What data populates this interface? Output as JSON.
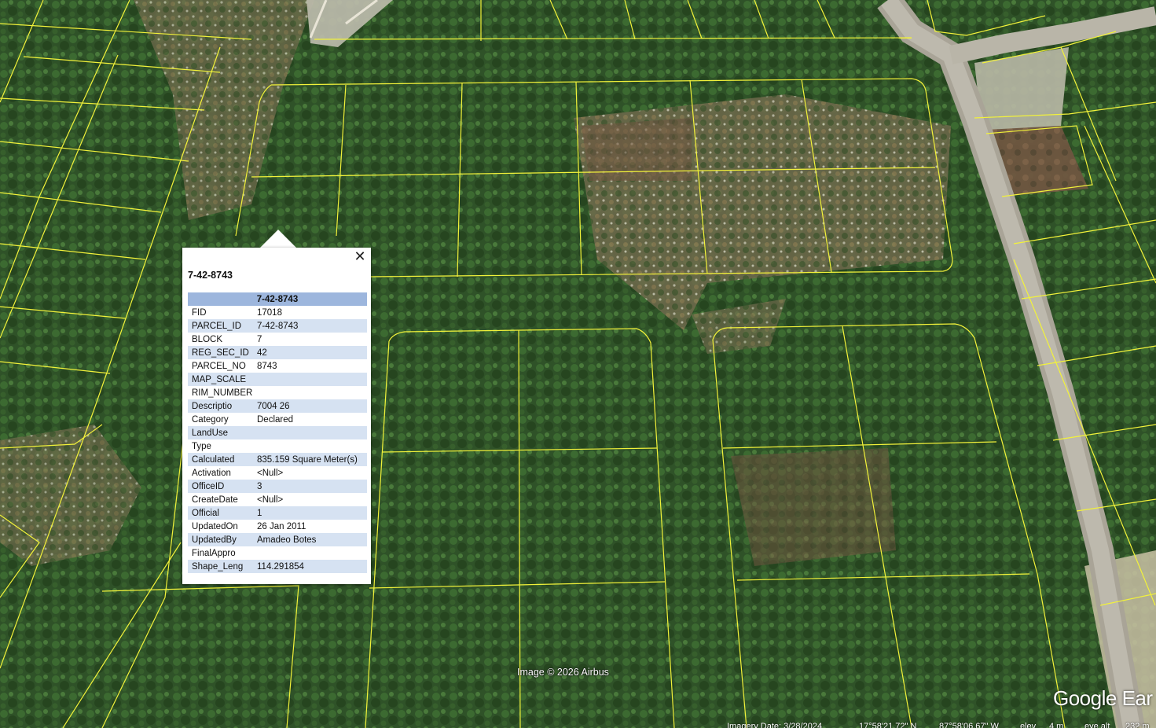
{
  "popup": {
    "title": "7-42-8743",
    "table_header": "7-42-8743",
    "close_glyph": "✕",
    "rows": [
      {
        "key": "FID",
        "value": "17018"
      },
      {
        "key": "PARCEL_ID",
        "value": "7-42-8743"
      },
      {
        "key": "BLOCK",
        "value": "7"
      },
      {
        "key": "REG_SEC_ID",
        "value": "42"
      },
      {
        "key": "PARCEL_NO",
        "value": "8743"
      },
      {
        "key": "MAP_SCALE",
        "value": ""
      },
      {
        "key": "RIM_NUMBER",
        "value": ""
      },
      {
        "key": "Descriptio",
        "value": "7004 26"
      },
      {
        "key": "Category",
        "value": "Declared"
      },
      {
        "key": "LandUse",
        "value": ""
      },
      {
        "key": "Type",
        "value": ""
      },
      {
        "key": "Calculated",
        "value": "835.159 Square Meter(s)"
      },
      {
        "key": "Activation",
        "value": "<Null>"
      },
      {
        "key": "OfficeID",
        "value": "3"
      },
      {
        "key": "CreateDate",
        "value": "<Null>"
      },
      {
        "key": "Official",
        "value": "1"
      },
      {
        "key": "UpdatedOn",
        "value": "26 Jan 2011"
      },
      {
        "key": "UpdatedBy",
        "value": "Amadeo Botes"
      },
      {
        "key": "FinalAppro",
        "value": ""
      },
      {
        "key": "Shape_Leng",
        "value": "114.291854"
      }
    ]
  },
  "map": {
    "credit": "Image © 2026 Airbus",
    "logo": "Google Ear",
    "parcel_line_color": "#f2f23a",
    "colors": {
      "forest": "#2f5228",
      "scrub": "#7a6a4a",
      "road": "#b8b4a8"
    }
  },
  "status_bar": {
    "imagery_date": "Imagery Date: 3/28/2024",
    "lat": "17°58'21.72\" N",
    "lon": "87°58'06.67\" W",
    "elev": "elev",
    "elev_value": "4 m",
    "eye_alt": "eye alt",
    "eye_alt_value": "232 m"
  }
}
